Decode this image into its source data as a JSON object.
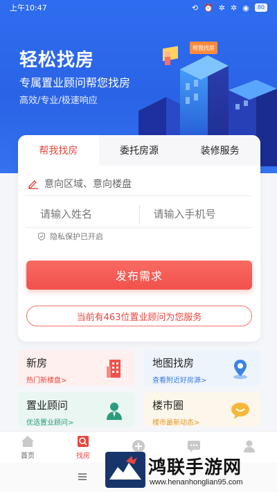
{
  "status_bar": {
    "time": "上午10:47",
    "battery": "80"
  },
  "hero": {
    "title": "轻松找房",
    "subtitle": "专属置业顾问帮您找房",
    "tags": "高效/专业/极速响应",
    "sign_text": "帮我找房"
  },
  "tabs": [
    {
      "label": "帮我找房",
      "active": true
    },
    {
      "label": "委托房源",
      "active": false
    },
    {
      "label": "装修服务",
      "active": false
    }
  ],
  "form": {
    "region_placeholder": "意向区域、意向楼盘",
    "name_placeholder": "请输入姓名",
    "phone_placeholder": "请输入手机号",
    "privacy_text": "隐私保护已开启",
    "submit_label": "发布需求",
    "advisor_count_text": "当前有463位置业顾问为您服务"
  },
  "tiles": [
    {
      "title": "新房",
      "subtitle": "热门新楼盘>",
      "icon": "building-icon"
    },
    {
      "title": "地图找房",
      "subtitle": "查看附近好房源>",
      "icon": "map-pin-icon"
    },
    {
      "title": "置业顾问",
      "subtitle": "优选置业顾问>",
      "icon": "advisor-icon"
    },
    {
      "title": "楼市圈",
      "subtitle": "楼市最新动态>",
      "icon": "chat-bubble-icon"
    }
  ],
  "nav": [
    {
      "label": "首页",
      "icon": "home-icon",
      "active": false
    },
    {
      "label": "找房",
      "icon": "find-house-icon",
      "active": true
    },
    {
      "label": "",
      "icon": "plus-icon",
      "active": false
    },
    {
      "label": "",
      "icon": "message-icon",
      "active": false
    },
    {
      "label": "",
      "icon": "profile-icon",
      "active": false
    }
  ],
  "watermark": {
    "name": "鸿联手游网",
    "url": "www.henanhonglian95.com"
  },
  "colors": {
    "brand_blue": "#2f6df0",
    "accent_red": "#e8463f"
  }
}
